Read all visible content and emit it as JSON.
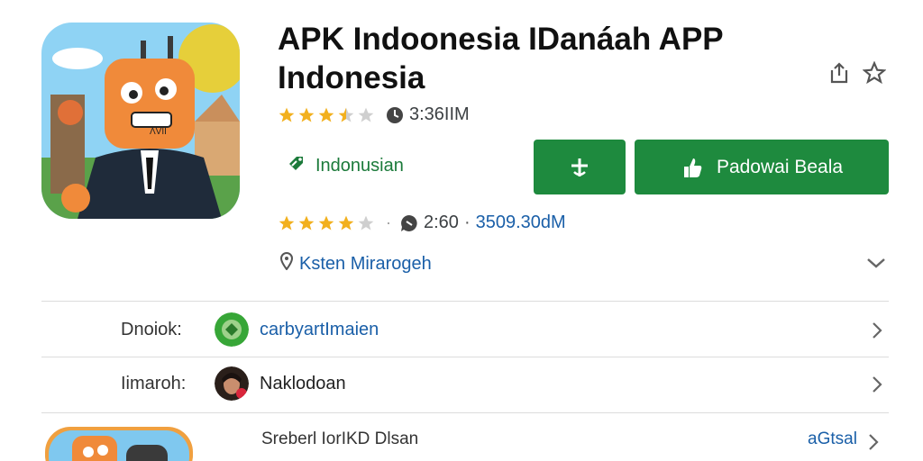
{
  "app": {
    "title": "APK Indoonesia IDanáah APP Indonesia",
    "icon_name": "app-robot-businessman-icon",
    "icon_label": "ΛVII"
  },
  "header_actions": {
    "share_icon": "share-icon",
    "wishlist_icon": "star-outline-icon"
  },
  "rating_primary": {
    "stars": 3.5,
    "downloads": "3:36IIM"
  },
  "language": {
    "label": "Indonusian",
    "icon": "tag-icon"
  },
  "buttons": {
    "small_icon": "plus-icon",
    "install_label": "Padowai Beala",
    "install_icon": "hand-icon"
  },
  "rating_secondary": {
    "stars": 4,
    "separator": "·",
    "reviews": "2:60",
    "dot": "·",
    "size": "3509.30dM"
  },
  "location": {
    "label": "Ksten Mirarogeh",
    "icon": "location-pin-icon"
  },
  "rows": [
    {
      "label": "Dnoiok:",
      "value": "carbyartImaien",
      "value_color": "#1a5fa8"
    },
    {
      "label": "Iimaroh:",
      "value": "Naklodoan",
      "value_color": "#222222"
    }
  ],
  "bottom": {
    "text": "Sreberl IorIKD Dlsan",
    "link": "aGtsal"
  },
  "colors": {
    "accent_green": "#1e8a3e",
    "link_blue": "#1a5fa8",
    "star_gold": "#f2b01e"
  }
}
